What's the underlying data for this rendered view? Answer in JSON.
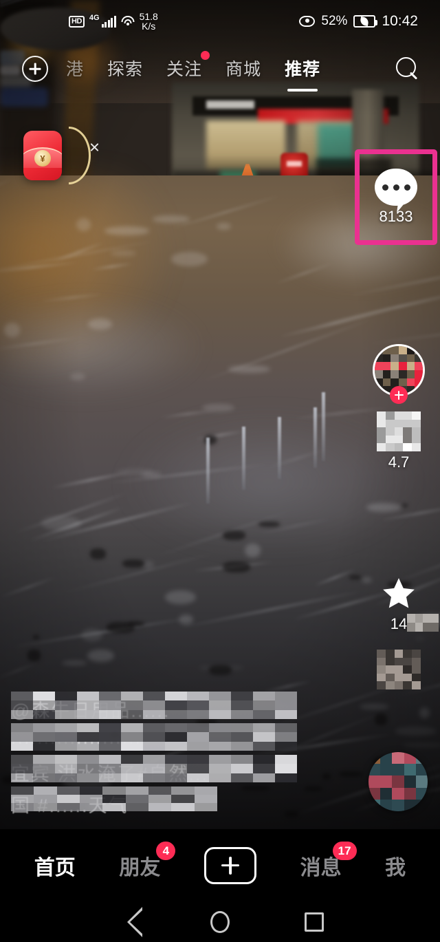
{
  "status_bar": {
    "hd_label": "HD",
    "network_type": "4G",
    "signal_icon": "signal-bars-icon",
    "wifi_icon": "wifi-icon",
    "net_speed_value": "51.8",
    "net_speed_unit": "K/s",
    "eye_icon": "eye-comfort-icon",
    "battery_percent": "52%",
    "battery_icon": "battery-eco-icon",
    "clock": "10:42"
  },
  "top_nav": {
    "add_button_icon": "plus-circle-icon",
    "search_icon": "search-icon",
    "tabs": [
      {
        "label": "港",
        "active": false,
        "dim": true,
        "dot": false
      },
      {
        "label": "探索",
        "active": false,
        "dim": false,
        "dot": false
      },
      {
        "label": "关注",
        "active": false,
        "dim": false,
        "dot": true
      },
      {
        "label": "商城",
        "active": false,
        "dim": false,
        "dot": false
      },
      {
        "label": "推荐",
        "active": true,
        "dim": false,
        "dot": false
      }
    ]
  },
  "red_packet": {
    "icon": "red-envelope-icon",
    "coin_glyph": "¥",
    "close_icon": "close-icon",
    "progress_arc": "progress-arc"
  },
  "action_rail": {
    "avatar": {
      "icon": "avatar",
      "follow_icon": "plus-follow-icon"
    },
    "like": {
      "icon": "heart-icon",
      "count": "4.7"
    },
    "comment": {
      "icon": "comment-bubble-icon",
      "count": "8133",
      "highlighted": true,
      "highlight_color": "#ea3190"
    },
    "favorite": {
      "icon": "star-icon",
      "count": "14"
    },
    "share": {
      "icon": "share-icon",
      "count": ""
    },
    "music_disc": {
      "icon": "music-disc-icon"
    }
  },
  "caption": {
    "lines": [
      "@森牛日用品......",
      "....................",
      "宜宾 洪水淹了#自然...",
      "国 #......天气"
    ],
    "obscured": true
  },
  "bottom_nav": {
    "items": [
      {
        "label": "首页",
        "active": true,
        "badge": ""
      },
      {
        "label": "朋友",
        "active": false,
        "badge": "4"
      },
      {
        "label": "",
        "active": false,
        "badge": "",
        "icon": "plus-box-icon"
      },
      {
        "label": "消息",
        "active": false,
        "badge": "17"
      },
      {
        "label": "我",
        "active": false,
        "badge": ""
      }
    ]
  },
  "android_nav": {
    "back_icon": "back-triangle-icon",
    "home_icon": "home-circle-icon",
    "recents_icon": "recents-square-icon"
  }
}
